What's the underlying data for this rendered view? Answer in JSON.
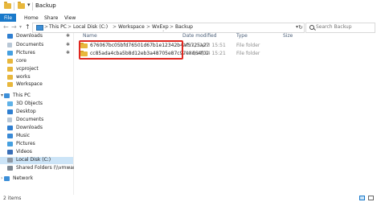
{
  "window": {
    "title": "Backup",
    "accent": "#1979ca",
    "folder_color": "#e8b73c",
    "highlight_color": "#e0261f"
  },
  "ribbon": {
    "tabs": [
      "File",
      "Home",
      "Share",
      "View"
    ]
  },
  "address": {
    "crumbs": [
      "This PC",
      "Local Disk (C:)",
      "Workspace",
      "WxExp",
      "Backup"
    ],
    "separator": ">"
  },
  "search": {
    "placeholder": "Search Backup"
  },
  "sidebar": {
    "quick_access": [
      {
        "label": "Downloads",
        "icon": "download-icon",
        "pinned": true
      },
      {
        "label": "Documents",
        "icon": "document-icon",
        "pinned": true
      },
      {
        "label": "Pictures",
        "icon": "picture-icon",
        "pinned": true
      },
      {
        "label": "core",
        "icon": "folder-icon",
        "pinned": false
      },
      {
        "label": "vcproject",
        "icon": "folder-icon",
        "pinned": false
      },
      {
        "label": "works",
        "icon": "folder-icon",
        "pinned": false
      },
      {
        "label": "Workspace",
        "icon": "folder-icon",
        "pinned": false
      }
    ],
    "this_pc": {
      "label": "This PC",
      "icon": "pc-icon"
    },
    "pc_items": [
      {
        "label": "3D Objects",
        "icon": "cube-icon"
      },
      {
        "label": "Desktop",
        "icon": "desktop-icon"
      },
      {
        "label": "Documents",
        "icon": "document-icon"
      },
      {
        "label": "Downloads",
        "icon": "download-icon"
      },
      {
        "label": "Music",
        "icon": "music-icon"
      },
      {
        "label": "Pictures",
        "icon": "picture-icon"
      },
      {
        "label": "Videos",
        "icon": "video-icon"
      },
      {
        "label": "Local Disk (C:)",
        "icon": "drive-icon",
        "selected": true
      },
      {
        "label": "Shared Folders (\\\\vmware-ho",
        "icon": "shared-drive-icon"
      }
    ],
    "network": {
      "label": "Network",
      "icon": "network-icon"
    }
  },
  "columns": {
    "name": "Name",
    "date_modified": "Date modified",
    "type": "Type",
    "size": "Size"
  },
  "files": [
    {
      "name": "676067bc05bfd76501d67b1e12342b4af5725a27",
      "date": "2021/12/23 15:51",
      "type": "File folder"
    },
    {
      "name": "cc85ada4cba5b8d12eb3a48705e87c97e8d64f02",
      "date": "2021/11/24 15:21",
      "type": "File folder"
    }
  ],
  "status": {
    "items": "2 items"
  }
}
